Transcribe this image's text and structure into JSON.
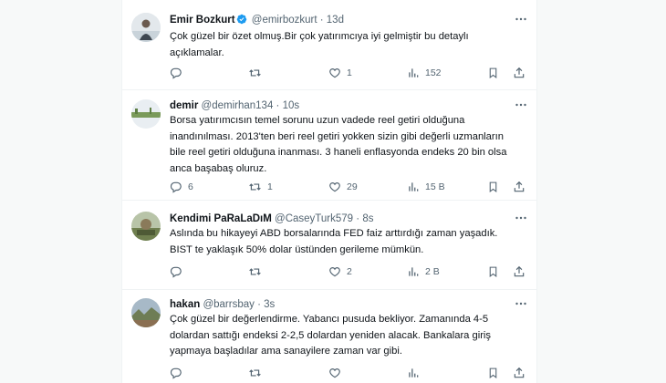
{
  "tweets": [
    {
      "name": "Emir Bozkurt",
      "handle": "@emirbozkurt",
      "separator": "·",
      "time": "13d",
      "verified": true,
      "text": "Çok güzel bir özet olmuş.Bir çok yatırımcıya iyi gelmiştir bu detaylı açıklamalar.",
      "replies": "",
      "retweets": "",
      "likes": "1",
      "views": "152"
    },
    {
      "name": "demir",
      "handle": "@demirhan134",
      "separator": "·",
      "time": "10s",
      "verified": false,
      "text": "Borsa yatırımcısın temel sorunu uzun vadede reel getiri olduğuna inandınılması. 2013'ten beri reel getiri yokken sizin gibi değerli uzmanların bile reel getiri olduğuna inanması. 3 haneli enflasyonda endeks 20 bin olsa anca başabaş oluruz.",
      "replies": "6",
      "retweets": "1",
      "likes": "29",
      "views": "15 B"
    },
    {
      "name": "Kendimi PaRaLaDıM",
      "handle": "@CaseyTurk579",
      "separator": "·",
      "time": "8s",
      "verified": false,
      "text": "Aslında bu hikayeyi ABD borsalarında FED faiz arttırdığı zaman yaşadık. BIST te yaklaşık 50% dolar üstünden gerileme mümkün.",
      "replies": "",
      "retweets": "",
      "likes": "2",
      "views": "2 B"
    },
    {
      "name": "hakan",
      "handle": "@barrsbay",
      "separator": "·",
      "time": "3s",
      "verified": false,
      "text": "Çok güzel bir değerlendirme. Yabancı pusuda bekliyor. Zamanında 4-5 dolardan sattığı endeksi 2-2,5 dolardan yeniden alacak. Bankalara giriş yapmaya başladılar ama sanayilere zaman var gibi.",
      "replies": "",
      "retweets": "",
      "likes": "",
      "views": ""
    }
  ],
  "colors": {
    "verified": "#1d9bf0",
    "muted": "#536471",
    "text": "#0f1419"
  }
}
